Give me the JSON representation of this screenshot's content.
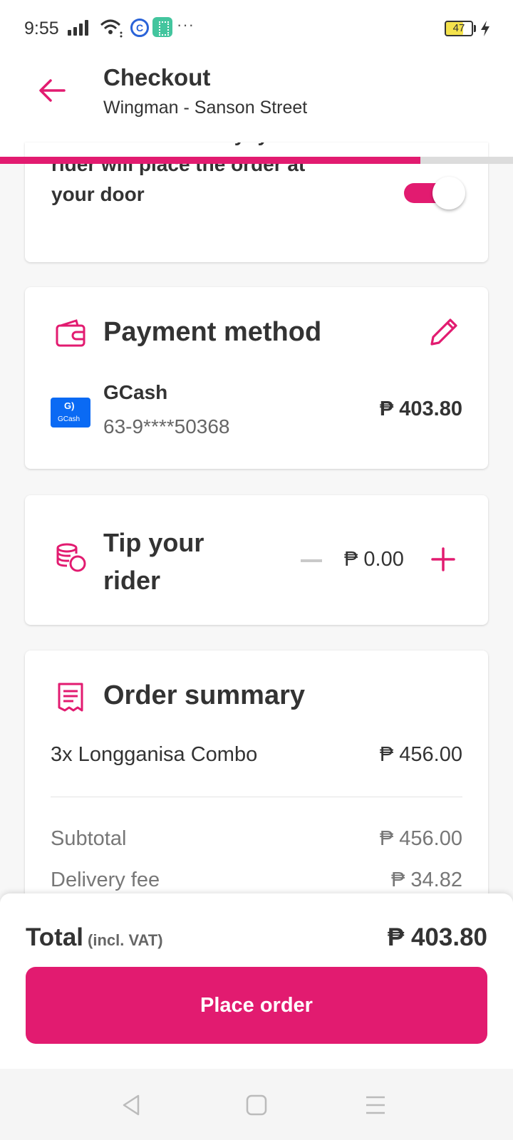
{
  "status_bar": {
    "time": "9:55",
    "battery": "47",
    "more": "···"
  },
  "header": {
    "title": "Checkout",
    "subtitle": "Wingman - Sanson Street",
    "progress_fraction": 0.82
  },
  "contactless": {
    "text": "Contactless delivery: your rider will place the order at your door",
    "toggle_on": true
  },
  "payment": {
    "title": "Payment method",
    "method_name": "GCash",
    "account": "63-9****50368",
    "amount": "₱ 403.80",
    "logo_text": "GCash"
  },
  "tip": {
    "title": "Tip your rider",
    "amount": "₱ 0.00"
  },
  "summary": {
    "title": "Order summary",
    "item_label": "3x Longganisa Combo",
    "item_price": "₱ 456.00",
    "subtotal_label": "Subtotal",
    "subtotal_value": "₱ 456.00",
    "delivery_label": "Delivery fee",
    "delivery_value": "₱ 34.82"
  },
  "footer": {
    "total_label": "Total",
    "total_note": "(incl. VAT)",
    "total_amount": "₱ 403.80",
    "place_order": "Place order"
  },
  "colors": {
    "accent": "#e21b70",
    "text": "#333333",
    "muted": "#777777",
    "gcash": "#0a6af4"
  }
}
